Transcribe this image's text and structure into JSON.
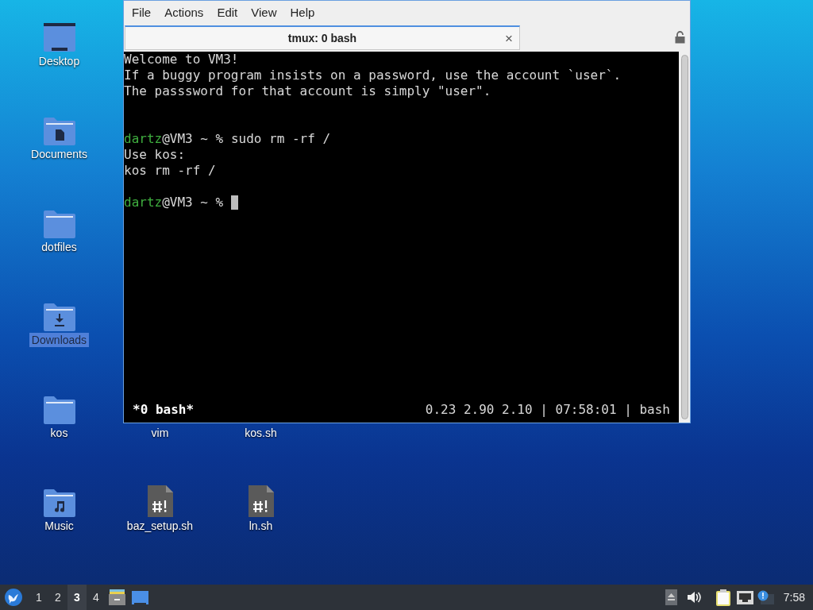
{
  "desktop_icons": [
    [
      {
        "label": "Desktop",
        "kind": "desktop",
        "selected": false
      },
      {
        "label": "Documents",
        "kind": "documents",
        "selected": false
      },
      {
        "label": "dotfiles",
        "kind": "folder",
        "selected": false
      },
      {
        "label": "Downloads",
        "kind": "downloads",
        "selected": true
      },
      {
        "label": "kos",
        "kind": "folder",
        "selected": false
      },
      {
        "label": "Music",
        "kind": "music",
        "selected": false
      }
    ],
    [
      {
        "label": "vim",
        "kind": "covered",
        "selected": false
      },
      {
        "label": "baz_setup.sh",
        "kind": "script",
        "selected": false
      }
    ],
    [
      {
        "label": "kos.sh",
        "kind": "covered",
        "selected": false
      },
      {
        "label": "ln.sh",
        "kind": "script",
        "selected": false
      }
    ]
  ],
  "window": {
    "menu": [
      "File",
      "Actions",
      "Edit",
      "View",
      "Help"
    ],
    "tab": {
      "title": "tmux: 0 bash",
      "close": "×"
    },
    "terminal": {
      "lines": [
        {
          "kind": "text",
          "text": "Welcome to VM3!"
        },
        {
          "kind": "text",
          "text": "If a buggy program insists on a password, use the account `user`."
        },
        {
          "kind": "text",
          "text": "The passsword for that account is simply \"user\"."
        },
        {
          "kind": "blank"
        },
        {
          "kind": "blank"
        },
        {
          "kind": "prompt",
          "user": "dartz",
          "rest": "@VM3 ~ % ",
          "command": "sudo rm -rf /",
          "cursor": false
        },
        {
          "kind": "text",
          "text": "Use kos:"
        },
        {
          "kind": "text",
          "text": "kos rm -rf /"
        },
        {
          "kind": "blank"
        },
        {
          "kind": "prompt",
          "user": "dartz",
          "rest": "@VM3 ~ % ",
          "cursor": true
        }
      ],
      "status_left": "*0 bash*",
      "status_right": "0.23 2.90 2.10 | 07:58:01 | bash"
    }
  },
  "taskbar": {
    "workspaces": [
      {
        "label": "1",
        "selected": false
      },
      {
        "label": "2",
        "selected": false
      },
      {
        "label": "3",
        "selected": true
      },
      {
        "label": "4",
        "selected": false
      }
    ],
    "clock": "7:58"
  }
}
